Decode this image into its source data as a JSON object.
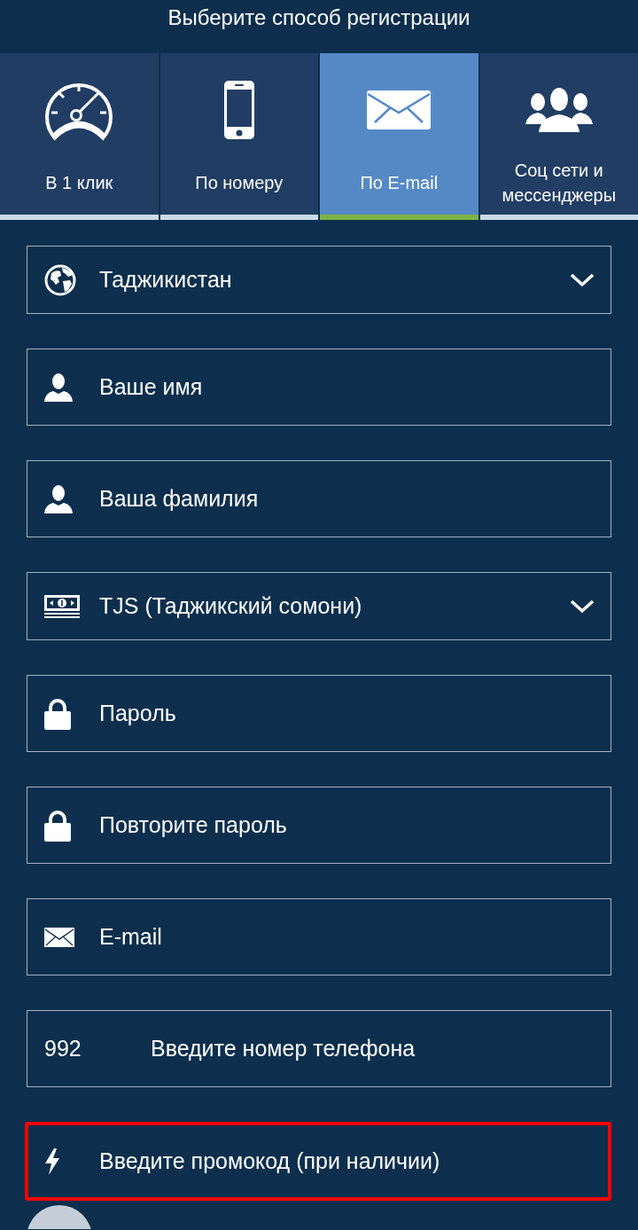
{
  "header": {
    "title": "Выберите способ регистрации"
  },
  "tabs": [
    {
      "kind": "quick",
      "label": "В 1 клик",
      "selected": false
    },
    {
      "kind": "phone",
      "label": "По номеру",
      "selected": false
    },
    {
      "kind": "email",
      "label": "По E-mail",
      "selected": true
    },
    {
      "kind": "social",
      "label": "Соц сети и мессенджеры",
      "selected": false
    }
  ],
  "fields": [
    {
      "kind": "country",
      "value": "Таджикистан"
    },
    {
      "kind": "name",
      "placeholder": "Ваше имя"
    },
    {
      "kind": "name",
      "placeholder": "Ваша фамилия"
    },
    {
      "kind": "currency",
      "value": "TJS (Таджикский сомони)"
    },
    {
      "kind": "password",
      "placeholder": "Пароль"
    },
    {
      "kind": "password",
      "placeholder": "Повторите пароль"
    },
    {
      "kind": "email",
      "placeholder": "E-mail"
    },
    {
      "kind": "phone",
      "prefix": "992",
      "placeholder": "Введите номер телефона"
    },
    {
      "kind": "promo",
      "placeholder": "Введите промокод (при наличии)",
      "highlighted": true
    }
  ]
}
